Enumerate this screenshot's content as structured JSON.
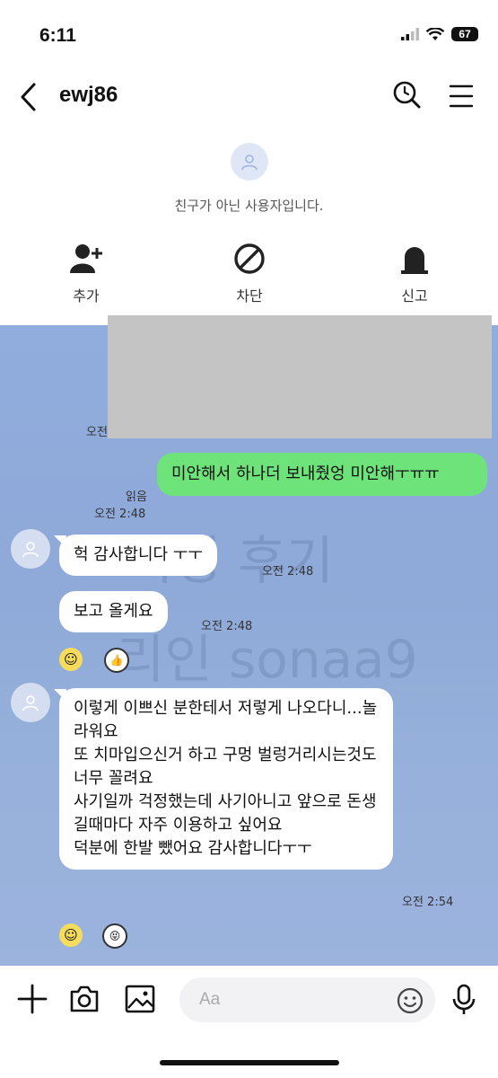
{
  "status": {
    "time": "6:11",
    "battery": "67"
  },
  "header": {
    "title": "ewj86"
  },
  "profile": {
    "notice": "친구가 아닌 사용자입니다.",
    "actions": [
      {
        "label": "추가",
        "icon": "add-friend-icon"
      },
      {
        "label": "차단",
        "icon": "block-icon"
      },
      {
        "label": "신고",
        "icon": "report-icon"
      }
    ]
  },
  "chat": {
    "watermark_line1": "지영 후기",
    "watermark_line2": "리인 sonaa9",
    "partial_time": "오전",
    "sent": {
      "text": "미안해서 하나더 보내줬엉 미안해ㅜㅠㅠ",
      "read_label": "읽음",
      "time": "오전 2:48"
    },
    "received": [
      {
        "text": "헉 감사합니다 ㅜㅜ",
        "time": "오전 2:48"
      },
      {
        "text": "보고 올게요",
        "time": "오전 2:48"
      },
      {
        "text": "이렇게 이쁘신 분한테서 저렇게 나오다니...놀라워요\n또 치마입으신거 하고 구멍 벌렁거리시는것도 너무 꼴려요\n사기일까 걱정했는데 사기아니고 앞으로 돈생길때마다 자주 이용하고 싶어요\n덕분에 한발 뺐어요 감사합니다ㅜㅜ",
        "time": "오전 2:54"
      }
    ]
  },
  "input": {
    "placeholder": "Aa"
  },
  "colors": {
    "sent_bubble": "#6ee37a",
    "chat_background": "#90addd",
    "received_bubble": "#ffffff"
  }
}
